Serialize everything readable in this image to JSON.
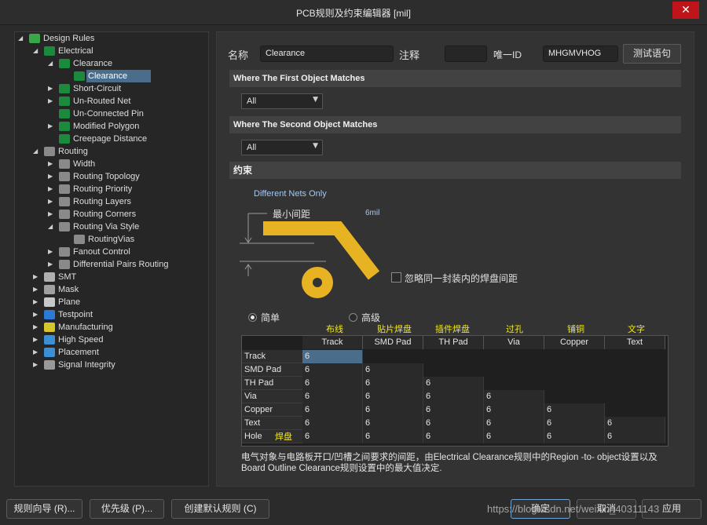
{
  "window": {
    "title": "PCB规则及约束编辑器 [mil]",
    "close_glyph": "✕"
  },
  "tree": {
    "items": [
      {
        "label": "Design Rules",
        "arrow": "◢",
        "icon": "rules-folder-icon"
      },
      {
        "label": "Electrical",
        "arrow": "◢",
        "icon": "electrical-icon"
      },
      {
        "label": "Clearance",
        "arrow": "◢",
        "icon": "clearance-icon"
      },
      {
        "label": "Clearance",
        "arrow": "",
        "icon": "clearance-rule-icon"
      },
      {
        "label": "Short-Circuit",
        "arrow": "▶",
        "icon": "short-circuit-icon"
      },
      {
        "label": "Un-Routed Net",
        "arrow": "▶",
        "icon": "unrouted-net-icon"
      },
      {
        "label": "Un-Connected Pin",
        "arrow": "",
        "icon": "unconnected-pin-icon"
      },
      {
        "label": "Modified Polygon",
        "arrow": "▶",
        "icon": "modified-polygon-icon"
      },
      {
        "label": "Creepage Distance",
        "arrow": "",
        "icon": "creepage-icon"
      },
      {
        "label": "Routing",
        "arrow": "◢",
        "icon": "routing-icon"
      },
      {
        "label": "Width",
        "arrow": "▶",
        "icon": "width-icon"
      },
      {
        "label": "Routing Topology",
        "arrow": "▶",
        "icon": "topology-icon"
      },
      {
        "label": "Routing Priority",
        "arrow": "▶",
        "icon": "priority-icon"
      },
      {
        "label": "Routing Layers",
        "arrow": "▶",
        "icon": "layers-icon"
      },
      {
        "label": "Routing Corners",
        "arrow": "▶",
        "icon": "corners-icon"
      },
      {
        "label": "Routing Via Style",
        "arrow": "◢",
        "icon": "via-style-icon"
      },
      {
        "label": "RoutingVias",
        "arrow": "",
        "icon": "routing-vias-icon"
      },
      {
        "label": "Fanout Control",
        "arrow": "▶",
        "icon": "fanout-icon"
      },
      {
        "label": "Differential Pairs Routing",
        "arrow": "▶",
        "icon": "diff-pairs-icon"
      },
      {
        "label": "SMT",
        "arrow": "▶",
        "icon": "smt-icon"
      },
      {
        "label": "Mask",
        "arrow": "▶",
        "icon": "mask-icon"
      },
      {
        "label": "Plane",
        "arrow": "▶",
        "icon": "plane-icon"
      },
      {
        "label": "Testpoint",
        "arrow": "▶",
        "icon": "testpoint-icon"
      },
      {
        "label": "Manufacturing",
        "arrow": "▶",
        "icon": "manufacturing-icon"
      },
      {
        "label": "High Speed",
        "arrow": "▶",
        "icon": "high-speed-icon"
      },
      {
        "label": "Placement",
        "arrow": "▶",
        "icon": "placement-icon"
      },
      {
        "label": "Signal Integrity",
        "arrow": "▶",
        "icon": "signal-integrity-icon"
      }
    ]
  },
  "form": {
    "name_label": "名称",
    "name_value": "Clearance",
    "comment_label": "注释",
    "comment_value": "",
    "uid_label": "唯一ID",
    "uid_value": "MHGMVHOG",
    "test_button": "测试语句"
  },
  "first_match": {
    "header": "Where The First Object Matches",
    "value": "All"
  },
  "second_match": {
    "header": "Where The Second Object Matches",
    "value": "All"
  },
  "constraints": {
    "header": "约束",
    "net_scope": "Different Nets Only",
    "min_clearance_label": "最小间距",
    "min_clearance_value": "6mil",
    "ignore_pad_label": "忽略同一封装内的焊盘间距",
    "mode_simple": "简单",
    "mode_advanced": "高级",
    "selected_mode": "简单"
  },
  "matrix": {
    "columns": [
      "Track",
      "SMD Pad",
      "TH Pad",
      "Via",
      "Copper",
      "Text"
    ],
    "column_notes": [
      "布线",
      "贴片焊盘",
      "插件焊盘",
      "过孔",
      "铺铜",
      "文字"
    ],
    "rows": [
      {
        "label": "Track",
        "values": [
          "6"
        ]
      },
      {
        "label": "SMD Pad",
        "values": [
          "6",
          "6"
        ]
      },
      {
        "label": "TH Pad",
        "values": [
          "6",
          "6",
          "6"
        ]
      },
      {
        "label": "Via",
        "values": [
          "6",
          "6",
          "6",
          "6"
        ]
      },
      {
        "label": "Copper",
        "values": [
          "6",
          "6",
          "6",
          "6",
          "6"
        ]
      },
      {
        "label": "Text",
        "values": [
          "6",
          "6",
          "6",
          "6",
          "6",
          "6"
        ]
      },
      {
        "label": "Hole",
        "values": [
          "6",
          "6",
          "6",
          "6",
          "6",
          "6"
        ]
      }
    ],
    "hole_note": "焊盘"
  },
  "description": "电气对象与电路板开口/凹槽之间要求的间距，由Electrical Clearance规则中的Region -to- object设置以及Board Outline Clearance规则设置中的最大值决定.",
  "footer": {
    "wizard_button": "规则向导 (R)...",
    "priority_button": "优先级 (P)...",
    "default_rules_button": "创建默认规则 (C)",
    "ok_button": "确定",
    "cancel_button": "取消",
    "apply_button": "应用",
    "watermark": "https://blog.csdn.net/weixin_40311143"
  },
  "colors": {
    "trace": "#e8b323",
    "selection": "#4a6d8c",
    "note_yellow": "#f2e81a"
  }
}
